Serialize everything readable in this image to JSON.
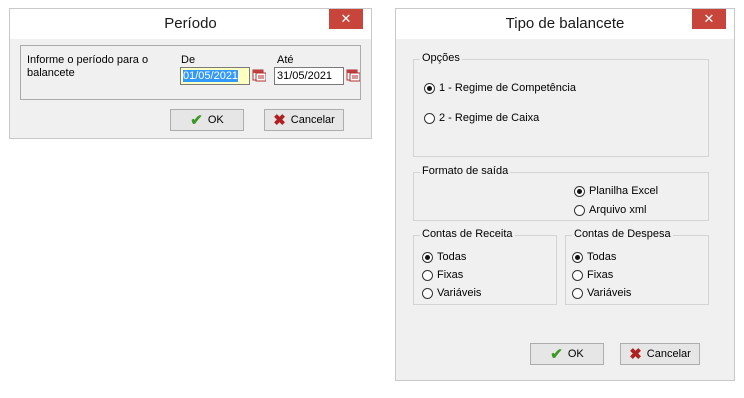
{
  "periodo": {
    "title": "Período",
    "close": "✕",
    "prompt": "Informe o período para o balancete",
    "de_label": "De",
    "ate_label": "Até",
    "de_value": "01/05/2021",
    "ate_value": "31/05/2021",
    "ok_label": "OK",
    "cancel_label": "Cancelar"
  },
  "balancete": {
    "title": "Tipo de balancete",
    "close": "✕",
    "opcoes": {
      "label": "Opções",
      "options": [
        "1 - Regime de Competência",
        "2 - Regime de Caixa"
      ],
      "selected": 0
    },
    "formato": {
      "label": "Formato de saída",
      "options": [
        "Planilha Excel",
        "Arquivo xml"
      ],
      "selected": 0
    },
    "receita": {
      "label": "Contas de Receita",
      "options": [
        "Todas",
        "Fixas",
        "Variáveis"
      ],
      "selected": 0
    },
    "despesa": {
      "label": "Contas de Despesa",
      "options": [
        "Todas",
        "Fixas",
        "Variáveis"
      ],
      "selected": 0
    },
    "ok_label": "OK",
    "cancel_label": "Cancelar"
  },
  "colors": {
    "check": "#3a9a22",
    "cross": "#b02020",
    "close_bg": "#c7453a",
    "selection": "#3399ff"
  },
  "icons": [
    "checkmark-icon",
    "cross-icon",
    "calendar-icon"
  ]
}
